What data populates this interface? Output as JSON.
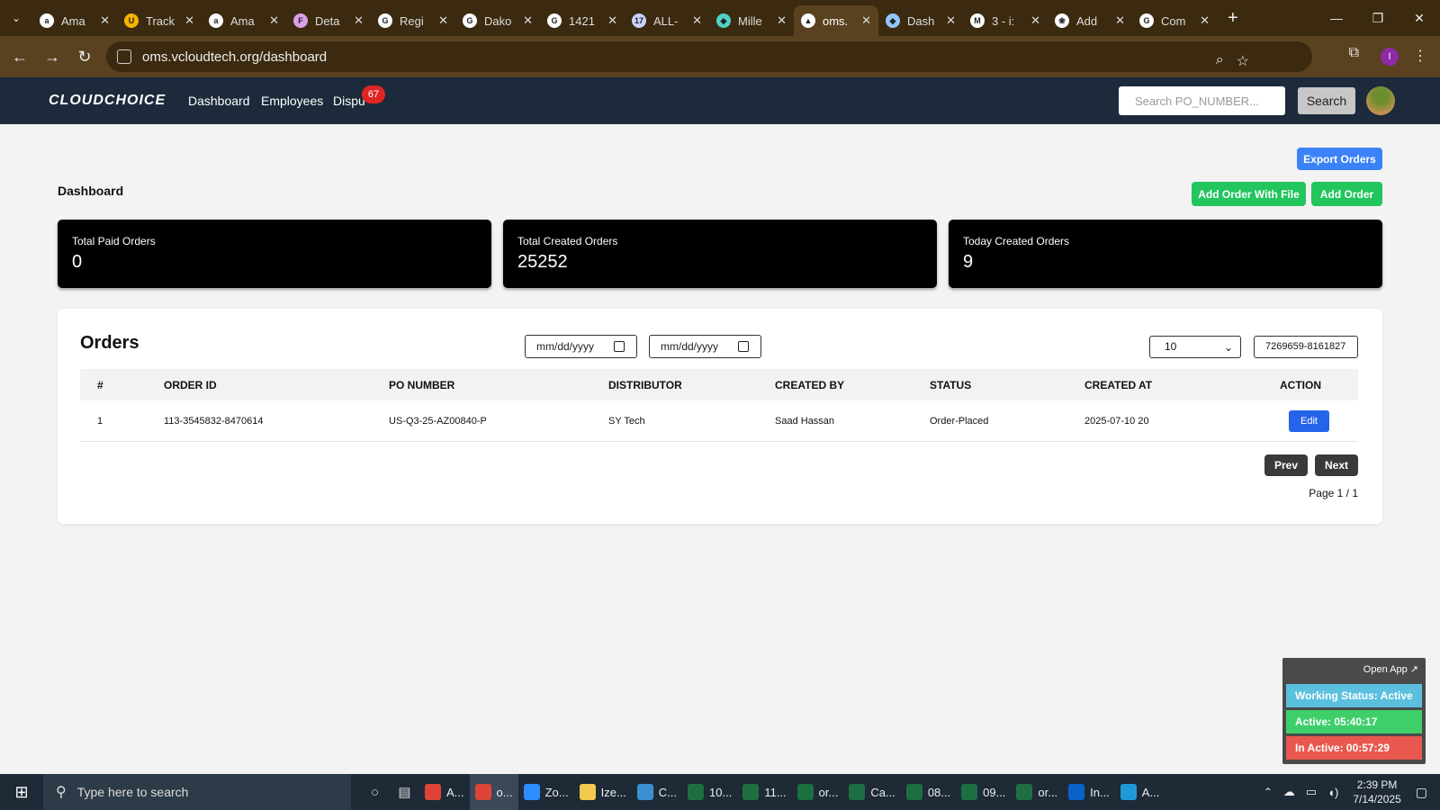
{
  "browser": {
    "tabs": [
      {
        "label": "Ama",
        "icon": "amazon-icon",
        "glyph": "a",
        "color": "#ffffff"
      },
      {
        "label": "Track",
        "icon": "ups-icon",
        "glyph": "U",
        "color": "#f5b400"
      },
      {
        "label": "Ama",
        "icon": "amazon-icon",
        "glyph": "a",
        "color": "#ffffff"
      },
      {
        "label": "Deta",
        "icon": "fedex-icon",
        "glyph": "F",
        "color": "#d9a0e8"
      },
      {
        "label": "Regi",
        "icon": "google-icon",
        "glyph": "G",
        "color": "#ffffff"
      },
      {
        "label": "Dako",
        "icon": "google-icon",
        "glyph": "G",
        "color": "#ffffff"
      },
      {
        "label": "1421",
        "icon": "google-icon",
        "glyph": "G",
        "color": "#ffffff"
      },
      {
        "label": "ALL-",
        "icon": "17track-icon",
        "glyph": "17",
        "color": "#c9d3ff"
      },
      {
        "label": "Mille",
        "icon": "ship-icon",
        "glyph": "◆",
        "color": "#4fd1c5"
      },
      {
        "label": "oms.",
        "icon": "triangle-icon",
        "glyph": "▲",
        "color": "#ffffff",
        "active": true
      },
      {
        "label": "Dash",
        "icon": "diamond-icon",
        "glyph": "◆",
        "color": "#93c5fd"
      },
      {
        "label": "3 - i:",
        "icon": "gmail-icon",
        "glyph": "M",
        "color": "#ffffff"
      },
      {
        "label": "Add",
        "icon": "chatgpt-icon",
        "glyph": "❀",
        "color": "#ffffff"
      },
      {
        "label": "Com",
        "icon": "google-icon",
        "glyph": "G",
        "color": "#ffffff"
      }
    ],
    "new_tab": "+",
    "url": "oms.vcloudtech.org/dashboard",
    "profile_initial": "I"
  },
  "app": {
    "logo": "CLOUDCHOICE",
    "nav": {
      "dashboard": "Dashboard",
      "employees": "Employees",
      "disputes": "Dispu",
      "disputes_count": "67"
    },
    "search": {
      "placeholder": "Search PO_NUMBER...",
      "button": "Search"
    }
  },
  "page": {
    "title": "Dashboard",
    "export_button": "Export Orders",
    "add_with_file_button": "Add Order With File",
    "add_order_button": "Add Order",
    "stats": [
      {
        "label": "Total Paid Orders",
        "value": "0"
      },
      {
        "label": "Total Created Orders",
        "value": "25252"
      },
      {
        "label": "Today Created Orders",
        "value": "9"
      }
    ]
  },
  "orders": {
    "title": "Orders",
    "date_from_placeholder": "mm/dd/yyyy",
    "date_to_placeholder": "mm/dd/yyyy",
    "page_size": "10",
    "filter_value": "7269659-8161827",
    "columns": [
      "#",
      "ORDER ID",
      "PO NUMBER",
      "DISTRIBUTOR",
      "CREATED BY",
      "STATUS",
      "CREATED AT",
      "ACTION"
    ],
    "rows": [
      {
        "num": "1",
        "order_id": "113-3545832-8470614",
        "po_number": "US-Q3-25-AZ00840-P",
        "distributor": "SY Tech",
        "created_by": "Saad Hassan",
        "status": "Order-Placed",
        "created_at": "2025-07-10 20",
        "action": "Edit"
      }
    ],
    "prev": "Prev",
    "next": "Next",
    "page_info": "Page 1 / 1"
  },
  "widget": {
    "open_app": "Open App ↗",
    "working_status": "Working Status: Active",
    "active": "Active: 05:40:17",
    "inactive": "In Active: 00:57:29",
    "colors": {
      "status": "#5bc0de",
      "active": "#3ecf6a",
      "inactive": "#e8584f"
    }
  },
  "taskbar": {
    "search_placeholder": "Type here to search",
    "apps": [
      {
        "label": "A...",
        "icon": "chrome-icon",
        "color": "#db4437"
      },
      {
        "label": "o...",
        "icon": "chrome-icon",
        "color": "#db4437",
        "active": true
      },
      {
        "label": "Zo...",
        "icon": "zoom-icon",
        "color": "#2d8cff"
      },
      {
        "label": "Ize...",
        "icon": "folder-icon",
        "color": "#f2c94c"
      },
      {
        "label": "C...",
        "icon": "vscode-icon",
        "color": "#3a8fd1"
      },
      {
        "label": "10...",
        "icon": "excel-icon",
        "color": "#1d6f42"
      },
      {
        "label": "11...",
        "icon": "excel-icon",
        "color": "#1d6f42"
      },
      {
        "label": "or...",
        "icon": "excel-icon",
        "color": "#1d6f42"
      },
      {
        "label": "Ca...",
        "icon": "excel-icon",
        "color": "#1d6f42"
      },
      {
        "label": "08...",
        "icon": "excel-icon",
        "color": "#1d6f42"
      },
      {
        "label": "09...",
        "icon": "excel-icon",
        "color": "#1d6f42"
      },
      {
        "label": "or...",
        "icon": "excel-icon",
        "color": "#1d6f42"
      },
      {
        "label": "In...",
        "icon": "outlook-icon",
        "color": "#0a64c8"
      },
      {
        "label": "A...",
        "icon": "edge-icon",
        "color": "#1f9ad6"
      }
    ],
    "time": "2:39 PM",
    "date": "7/14/2025"
  }
}
